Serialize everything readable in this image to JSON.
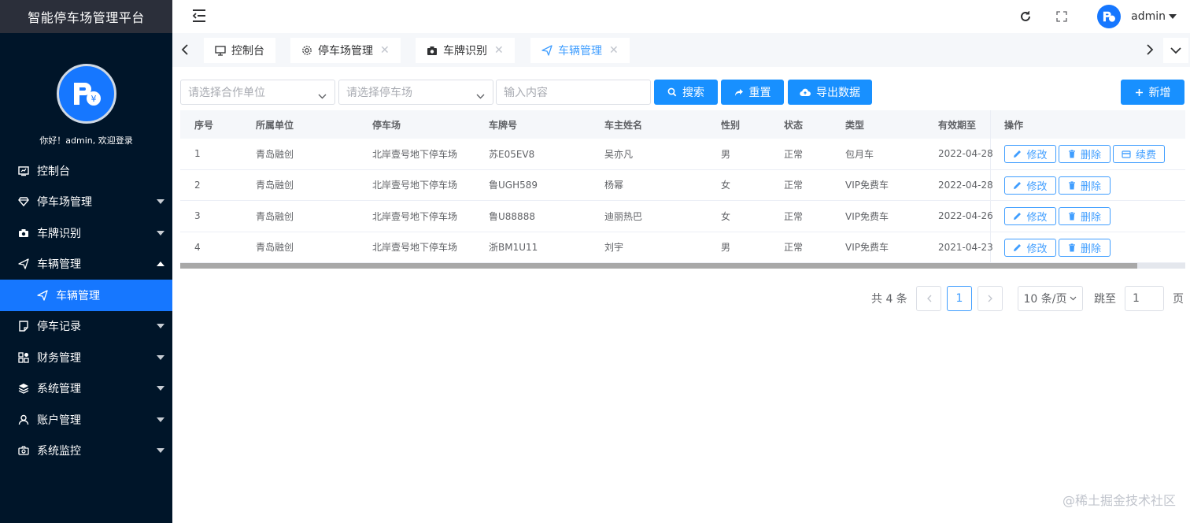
{
  "brand": {
    "title": "智能停车场管理平台"
  },
  "user": {
    "welcome": "你好！admin, 欢迎登录",
    "name": "admin"
  },
  "sidebar": {
    "items": [
      {
        "label": "控制台",
        "icon": "dashboard-icon",
        "expandable": false
      },
      {
        "label": "停车场管理",
        "icon": "diamond-icon",
        "expandable": true
      },
      {
        "label": "车牌识别",
        "icon": "camera-icon",
        "expandable": true
      },
      {
        "label": "车辆管理",
        "icon": "send-icon",
        "expandable": true,
        "expanded": true
      },
      {
        "label": "车辆管理",
        "icon": "send-icon",
        "sub": true,
        "active": true
      },
      {
        "label": "停车记录",
        "icon": "note-icon",
        "expandable": true
      },
      {
        "label": "财务管理",
        "icon": "grid-icon",
        "expandable": true
      },
      {
        "label": "系统管理",
        "icon": "layers-icon",
        "expandable": true
      },
      {
        "label": "账户管理",
        "icon": "user-icon",
        "expandable": true
      },
      {
        "label": "系统监控",
        "icon": "camera-outline-icon",
        "expandable": true
      }
    ]
  },
  "tabs": [
    {
      "label": "控制台",
      "icon": "monitor-icon",
      "closable": false
    },
    {
      "label": "停车场管理",
      "icon": "gear-icon",
      "closable": true
    },
    {
      "label": "车牌识别",
      "icon": "camera-icon",
      "closable": true
    },
    {
      "label": "车辆管理",
      "icon": "send-icon",
      "closable": true,
      "active": true
    }
  ],
  "filters": {
    "unit_placeholder": "请选择合作单位",
    "lot_placeholder": "请选择停车场",
    "keyword_placeholder": "输入内容"
  },
  "buttons": {
    "search": "搜索",
    "reset": "重置",
    "export": "导出数据",
    "add": "新增"
  },
  "table": {
    "headers": [
      "序号",
      "所属单位",
      "停车场",
      "车牌号",
      "车主姓名",
      "性别",
      "状态",
      "类型",
      "有效期至",
      "操作"
    ],
    "rows": [
      [
        "1",
        "青岛融创",
        "北岸壹号地下停车场",
        "苏E05EV8",
        "吴亦凡",
        "男",
        "正常",
        "包月车",
        "2022-04-28"
      ],
      [
        "2",
        "青岛融创",
        "北岸壹号地下停车场",
        "鲁UGH589",
        "杨幂",
        "女",
        "正常",
        "VIP免费车",
        "2022-04-28"
      ],
      [
        "3",
        "青岛融创",
        "北岸壹号地下停车场",
        "鲁U88888",
        "迪丽热巴",
        "女",
        "正常",
        "VIP免费车",
        "2022-04-26"
      ],
      [
        "4",
        "青岛融创",
        "北岸壹号地下停车场",
        "浙BM1U11",
        "刘宇",
        "男",
        "正常",
        "VIP免费车",
        "2021-04-23"
      ]
    ],
    "actions": {
      "edit": "修改",
      "delete": "删除",
      "renew": "续费"
    }
  },
  "pagination": {
    "total": "共 4 条",
    "page": "1",
    "page_size": "10 条/页",
    "goto_label": "跳至",
    "goto_value": "1",
    "page_unit": "页"
  },
  "watermark": "@稀土掘金技术社区",
  "colors": {
    "sidebar_bg": "#001529",
    "accent": "#1890ff",
    "active_menu": "#1677ff"
  }
}
